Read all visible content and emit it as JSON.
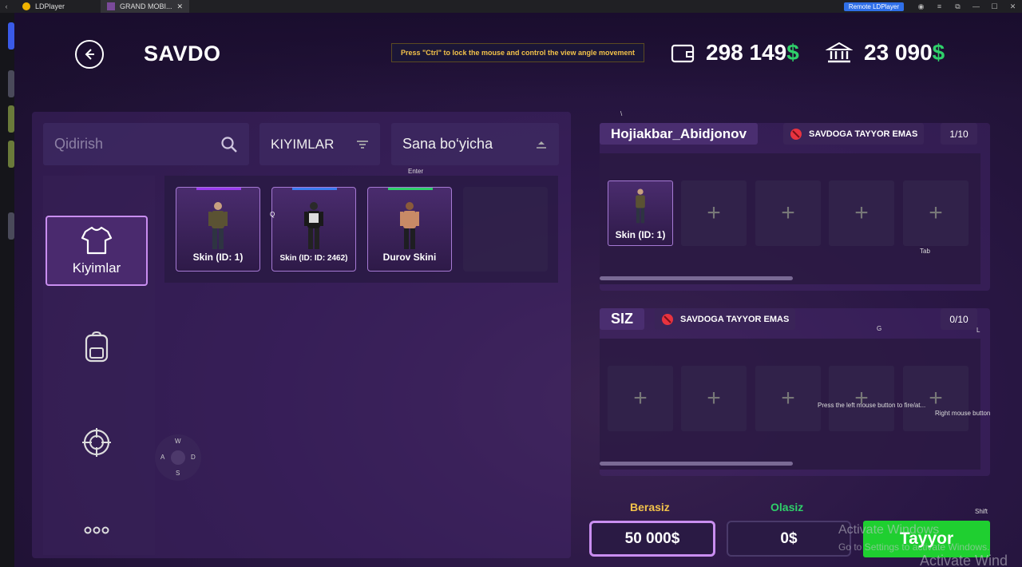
{
  "window": {
    "app_name": "LDPlayer",
    "tab_title": "GRAND MOBI...",
    "remote_label": "Remote LDPlayer",
    "back_icon": "arrow-left-icon",
    "controls": [
      "account-icon",
      "menu-icon",
      "restore-icon",
      "minimize-icon",
      "maximize-icon",
      "close-icon"
    ]
  },
  "header": {
    "title": "SAVDO",
    "hint": "Press \"Ctrl\" to lock the mouse and control the view angle movement",
    "wallet_amount": "298 149",
    "bank_amount": "23 090",
    "currency": "$"
  },
  "search": {
    "placeholder": "Qidirish"
  },
  "filters": {
    "category": "KIYIMLAR",
    "sort": "Sana bo‘yicha"
  },
  "categories": [
    {
      "label": "Kiyimlar",
      "icon": "tshirt-icon",
      "active": true
    },
    {
      "label": "",
      "icon": "backpack-icon",
      "active": false
    },
    {
      "label": "",
      "icon": "crosshair-icon",
      "active": false
    },
    {
      "label": "",
      "icon": "more-dots-icon",
      "active": false
    }
  ],
  "inventory_items": [
    {
      "label": "Skin (ID: 1)",
      "bar_color": "#9b3cf0"
    },
    {
      "label": "Skin (ID: ID: 2462)",
      "bar_color": "#3c7cf0"
    },
    {
      "label": "Durov Skini",
      "bar_color": "#2fd06a"
    }
  ],
  "partner": {
    "name": "Hojiakbar_Abidjonov",
    "status": "SAVDOGA TAYYOR EMAS",
    "count": "1/10",
    "items": [
      {
        "label": "Skin (ID: 1)"
      }
    ],
    "empty_slot_symbol": "+"
  },
  "self": {
    "name": "SIZ",
    "status": "SAVDOGA TAYYOR EMAS",
    "count": "0/10",
    "empty_slot_symbol": "+"
  },
  "price": {
    "barter_label": "Berasiz",
    "barter_value": "50 000",
    "receive_label": "Olasiz",
    "receive_value": "0",
    "currency": "$"
  },
  "ready_button": "Tayyor",
  "key_overlays": {
    "enter": "Enter",
    "q": "Q",
    "backslash": "\\",
    "tab": "Tab",
    "g": "G",
    "l": "L",
    "fire": "Press the left mouse button to fire/at...",
    "right_mouse": "Right mouse button",
    "shift": "Shift",
    "joystick": {
      "up": "W",
      "left": "A",
      "right": "D",
      "down": "S"
    }
  },
  "watermark": {
    "line1": "Activate Windows",
    "line2": "Go to Settings to activate Windows.",
    "line3": "Activate Wind"
  },
  "colors": {
    "accent_purple": "#c98ef0",
    "money_green": "#2fd06a",
    "ready_green": "#1fcf30",
    "hint_text": "#f2c24a",
    "barter_label": "#f2c24a",
    "receive_label": "#2fd06a",
    "status_icon": "#e8333f"
  }
}
